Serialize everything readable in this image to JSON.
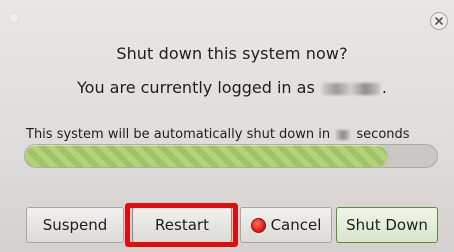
{
  "dialog": {
    "title": "Shut down this system now?",
    "logged_in_prefix": "You are currently logged in as",
    "logged_in_suffix": ".",
    "countdown_prefix": "This system will be automatically shut down in",
    "countdown_suffix": "seconds",
    "progress_fraction": 0.88,
    "close_icon": "close-icon"
  },
  "buttons": {
    "suspend": "Suspend",
    "restart": "Restart",
    "cancel": "Cancel",
    "shutdown": "Shut Down"
  },
  "colors": {
    "progress_fill": "#a9cb70",
    "highlight": "#e10d0d",
    "cancel_icon": "#d21a12"
  }
}
